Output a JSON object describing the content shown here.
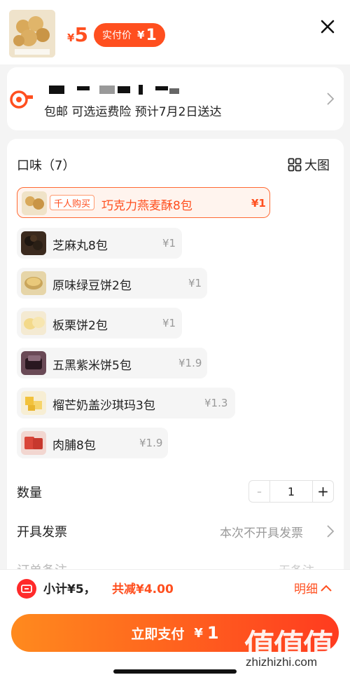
{
  "header": {
    "orig_price_currency": "¥",
    "orig_price": "5",
    "real_price_label": "实付价",
    "real_price_currency": "¥",
    "real_price": "1",
    "close_icon": "close-icon"
  },
  "address": {
    "line": "包邮  可选运费险  预计7月2日送达",
    "icon": "location-icon"
  },
  "flavors": {
    "title": "口味（7）",
    "big_view_label": "大图",
    "items": [
      {
        "badge": "千人购买",
        "name": "巧克力燕麦酥8包",
        "price": "¥1"
      },
      {
        "name": "芝麻丸8包",
        "price": "¥1"
      },
      {
        "name": "原味绿豆饼2包",
        "price": "¥1"
      },
      {
        "name": "板栗饼2包",
        "price": "¥1"
      },
      {
        "name": "五黑紫米饼5包",
        "price": "¥1.9"
      },
      {
        "name": "榴芒奶盖沙琪玛3包",
        "price": "¥1.3"
      },
      {
        "name": "肉脯8包",
        "price": "¥1.9"
      }
    ]
  },
  "quantity": {
    "label": "数量",
    "minus": "-",
    "value": "1",
    "plus": "+"
  },
  "invoice": {
    "label": "开具发票",
    "value": "本次不开具发票"
  },
  "note": {
    "label": "订单备注",
    "value": "无备注"
  },
  "footer": {
    "subtotal": "小计¥5，",
    "discount": "共减¥4.00",
    "detail_label": "明细",
    "pay_label": "立即支付",
    "pay_currency": "¥",
    "pay_amount": "1"
  },
  "watermark": {
    "glyphs": "值值值",
    "text": "zhizhizhi.com"
  },
  "colors": {
    "accent": "#ff4f1f",
    "selected_bg": "#fff4ee",
    "option_bg": "#f5f5f5",
    "page_bg": "#f4f4f4"
  }
}
